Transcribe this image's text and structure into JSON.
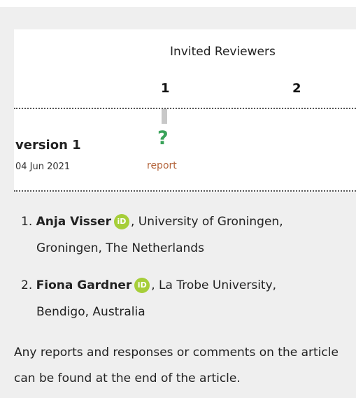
{
  "header": {
    "title": "Invited Reviewers",
    "columns": [
      "1",
      "2"
    ]
  },
  "version": {
    "label": "version 1",
    "date": "04 Jun 2021",
    "status_symbol": "?",
    "report_label": "report"
  },
  "reviewers": [
    {
      "number": "1.",
      "name": "Anja Visser",
      "affiliation_line1": ", University of Groningen,",
      "affiliation_line2": "Groningen, The Netherlands"
    },
    {
      "number": "2.",
      "name": "Fiona Gardner",
      "affiliation_line1": ", La Trobe University,",
      "affiliation_line2": "Bendigo, Australia"
    }
  ],
  "orcid_icon_text": "iD",
  "footer_note": "Any reports and responses or comments on the article can be found at the end of the article.",
  "colors": {
    "panel_bg": "#efefef",
    "status_green": "#3aa35a",
    "link_orange": "#b4653c",
    "orcid_green": "#a6ce39"
  }
}
